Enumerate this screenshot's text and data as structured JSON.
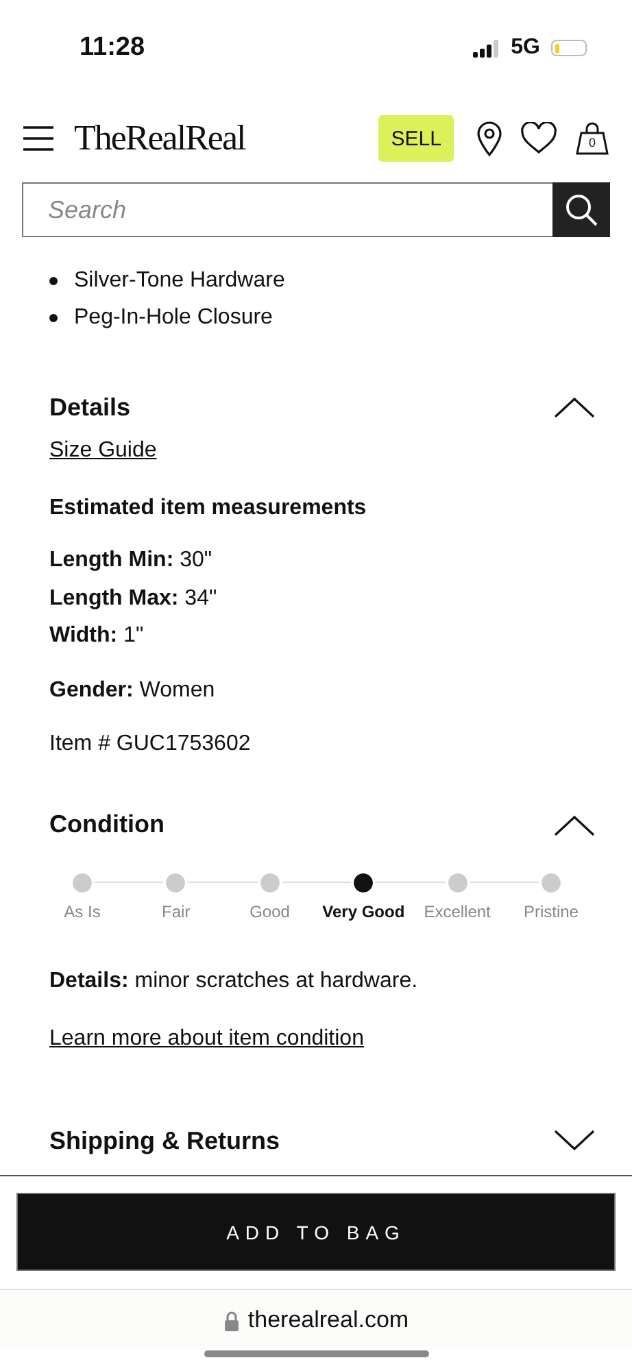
{
  "status_bar": {
    "time": "11:28",
    "network": "5G"
  },
  "header": {
    "logo": "TheRealReal",
    "sell_button": "SELL",
    "bag_count": "0"
  },
  "search": {
    "placeholder": "Search"
  },
  "bullets": [
    "Silver-Tone Hardware",
    "Peg-In-Hole Closure"
  ],
  "details": {
    "title": "Details",
    "expanded": true,
    "size_guide": "Size Guide",
    "measurements_title": "Estimated item measurements",
    "measurements": [
      "**Length Min:** 30\"",
      "**Length Max:** 34\"",
      "**Width:** 1\""
    ],
    "gender": "**Gender:** Women",
    "item_number": "Item # GUC1753602"
  },
  "condition": {
    "title": "Condition",
    "expanded": true,
    "scale": [
      {
        "label": "As Is",
        "selected": false
      },
      {
        "label": "Fair",
        "selected": false
      },
      {
        "label": "Good",
        "selected": false
      },
      {
        "label": "Very Good",
        "selected": true
      },
      {
        "label": "Excellent",
        "selected": false
      },
      {
        "label": "Pristine",
        "selected": false
      }
    ],
    "details": "**Details:** minor scratches at hardware.",
    "learn_more": "Learn more about item condition"
  },
  "shipping": {
    "title": "Shipping & Returns",
    "expanded": false
  },
  "add_to_bag": "ADD TO BAG",
  "url_bar": {
    "domain": "therealreal.com"
  }
}
